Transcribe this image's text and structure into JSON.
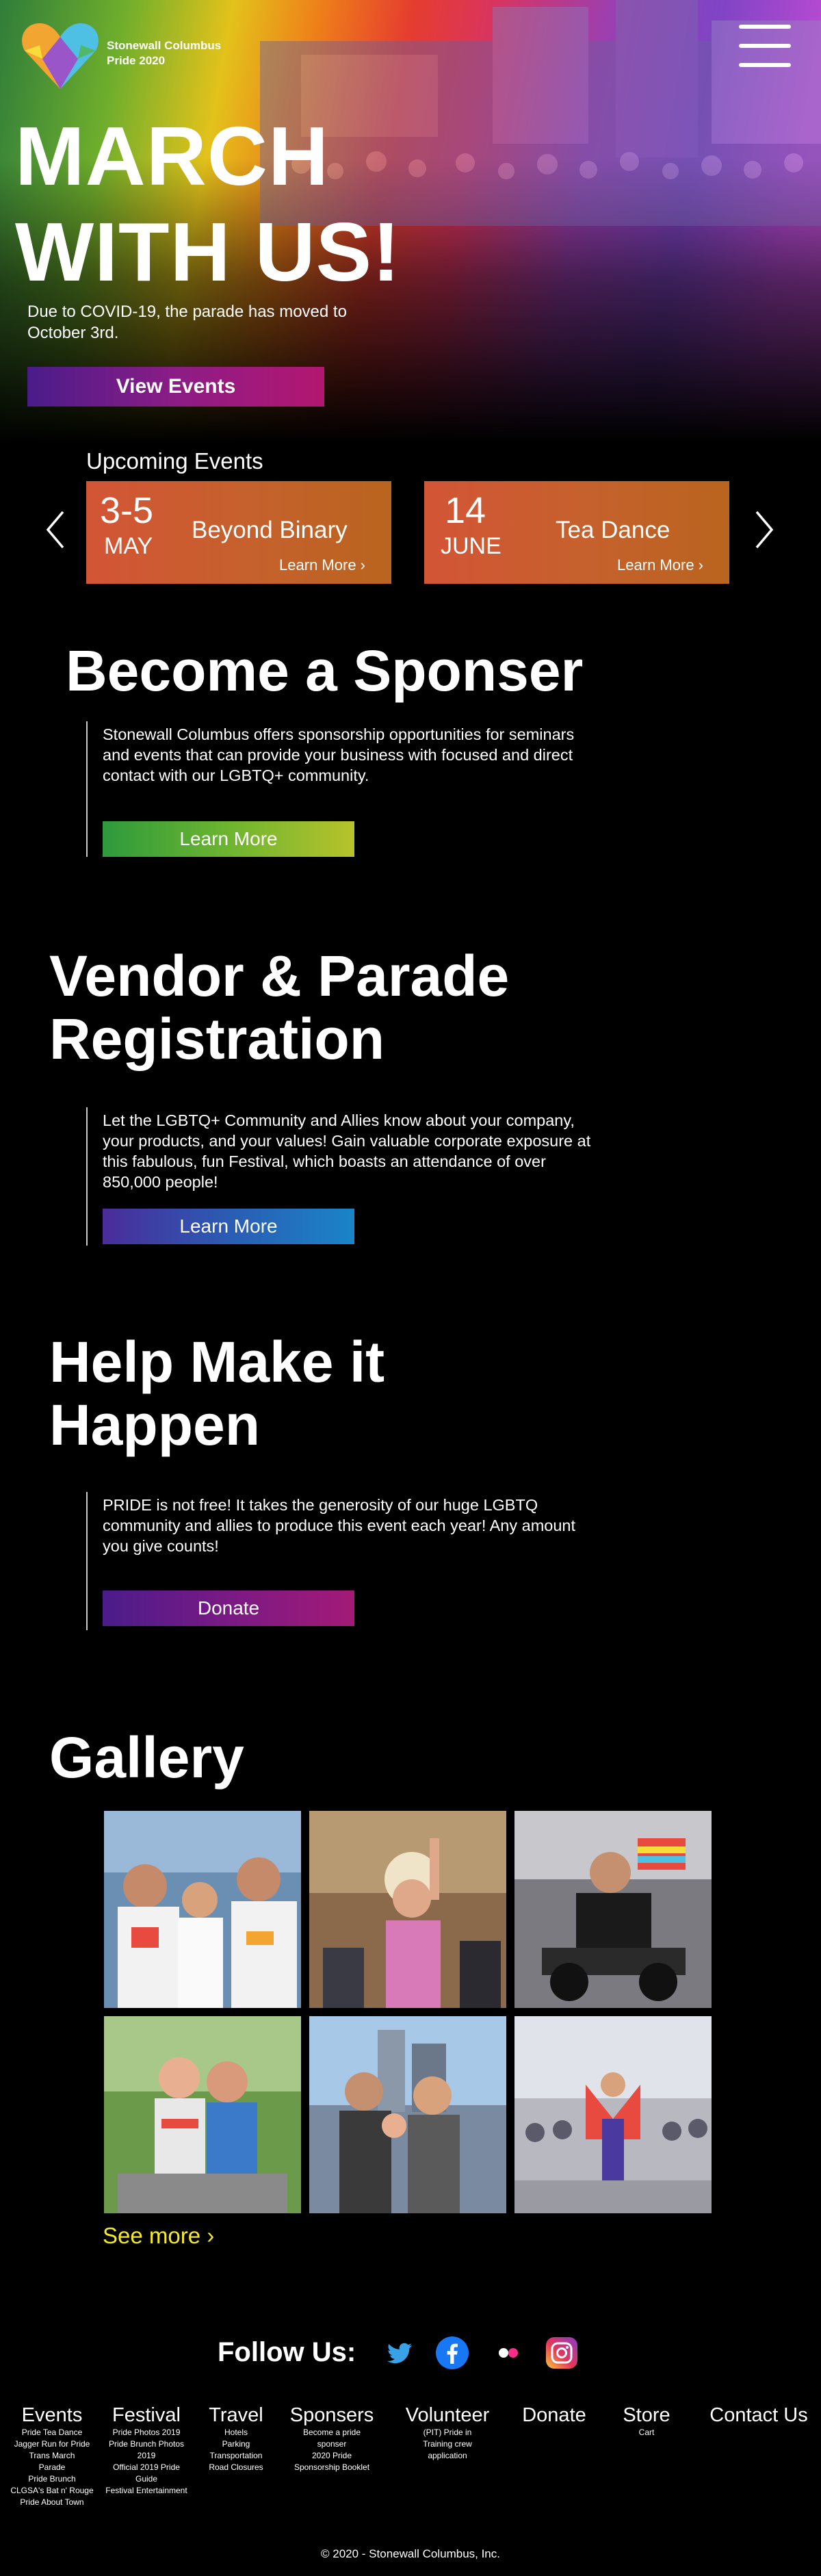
{
  "brand": {
    "line1": "Stonewall Columbus",
    "line2": "Pride 2020"
  },
  "hero": {
    "title_line1": "MARCH",
    "title_line2": "WITH US!",
    "subtitle": "Due to COVID-19, the parade has moved to October 3rd.",
    "button": "View Events"
  },
  "events": {
    "heading": "Upcoming Events",
    "items": [
      {
        "date": "3-5",
        "month": "MAY",
        "name": "Beyond Binary",
        "link": "Learn More ›"
      },
      {
        "date": "14",
        "month": "JUNE",
        "name": "Tea Dance",
        "link": "Learn More ›"
      }
    ],
    "prev_icon": "chevron-left-icon",
    "next_icon": "chevron-right-icon"
  },
  "sponsor": {
    "title": "Become a Sponser",
    "text": "Stonewall Columbus offers sponsorship opportunities for seminars and events that can provide your business with focused and direct contact with our LGBTQ+ community.",
    "button": "Learn More"
  },
  "vendor": {
    "title_line1": "Vendor & Parade",
    "title_line2": "Registration",
    "text": "Let the LGBTQ+ Community and Allies know about your company, your products, and your values! Gain valuable corporate exposure at this fabulous, fun Festival, which boasts an attendance of over 850,000 people!",
    "button": "Learn More"
  },
  "help": {
    "title_line1": "Help Make it",
    "title_line2": "Happen",
    "text": "PRIDE is not free! It takes the generosity of our huge LGBTQ community and allies to produce this event each year! Any amount you give counts!",
    "button": "Donate"
  },
  "gallery": {
    "title": "Gallery",
    "see_more": "See more ›"
  },
  "social": {
    "label": "Follow Us:",
    "icons": [
      "twitter-icon",
      "facebook-icon",
      "flickr-icon",
      "instagram-icon"
    ]
  },
  "footer": {
    "columns": [
      {
        "title": "Events",
        "items": [
          "Pride Tea Dance",
          "Jagger Run for Pride",
          "Trans March",
          "Parade",
          "Pride Brunch",
          "CLGSA's Bat n' Rouge",
          "Pride About Town"
        ]
      },
      {
        "title": "Festival",
        "items": [
          "Pride Photos 2019",
          "Pride Brunch Photos 2019",
          "Official 2019 Pride Guide",
          "Festival Entertainment"
        ]
      },
      {
        "title": "Travel",
        "items": [
          "Hotels",
          "Parking",
          "Transportation",
          "Road Closures"
        ]
      },
      {
        "title": "Sponsers",
        "items": [
          "Become a pride sponser",
          "2020 Pride Sponsorship Booklet"
        ]
      },
      {
        "title": "Volunteer",
        "items": [
          "(PIT) Pride in Training crew application"
        ]
      },
      {
        "title": "Donate",
        "items": []
      },
      {
        "title": "Store",
        "items": [
          "Cart"
        ]
      },
      {
        "title": "Contact Us",
        "items": []
      }
    ],
    "copyright": "© 2020 - Stonewall Columbus, Inc."
  },
  "colors": {
    "event_card": "#c95a30",
    "see_more": "#f4ea26",
    "view_events_gradient": [
      "#4a1c8a",
      "#b31770"
    ],
    "sponsor_button_gradient": [
      "#2e9a3c",
      "#b7c22c"
    ],
    "vendor_button_gradient": [
      "#4a2c9a",
      "#1a84c8"
    ],
    "donate_button_gradient": [
      "#4a1c8a",
      "#a31a76"
    ]
  }
}
